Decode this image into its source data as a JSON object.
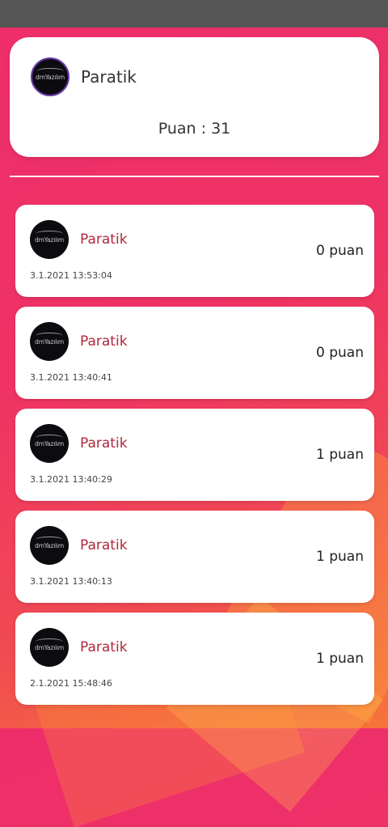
{
  "profile": {
    "avatar_logo": "dmYazılım",
    "name": "Paratik",
    "score_label": "Puan : 31"
  },
  "entries": [
    {
      "avatar_logo": "dmYazılım",
      "name": "Paratik",
      "points": "0 puan",
      "date": "3.1.2021 13:53:04"
    },
    {
      "avatar_logo": "dmYazılım",
      "name": "Paratik",
      "points": "0 puan",
      "date": "3.1.2021 13:40:41"
    },
    {
      "avatar_logo": "dmYazılım",
      "name": "Paratik",
      "points": "1 puan",
      "date": "3.1.2021 13:40:29"
    },
    {
      "avatar_logo": "dmYazılım",
      "name": "Paratik",
      "points": "1 puan",
      "date": "3.1.2021 13:40:13"
    },
    {
      "avatar_logo": "dmYazılım",
      "name": "Paratik",
      "points": "1 puan",
      "date": "2.1.2021 15:48:46"
    }
  ],
  "colors": {
    "background_top": "#ee2e6b",
    "background_bottom": "#f5743a",
    "status_bar": "#555555",
    "entry_name": "#b0283a",
    "avatar_ring": "#6a3aa8"
  }
}
